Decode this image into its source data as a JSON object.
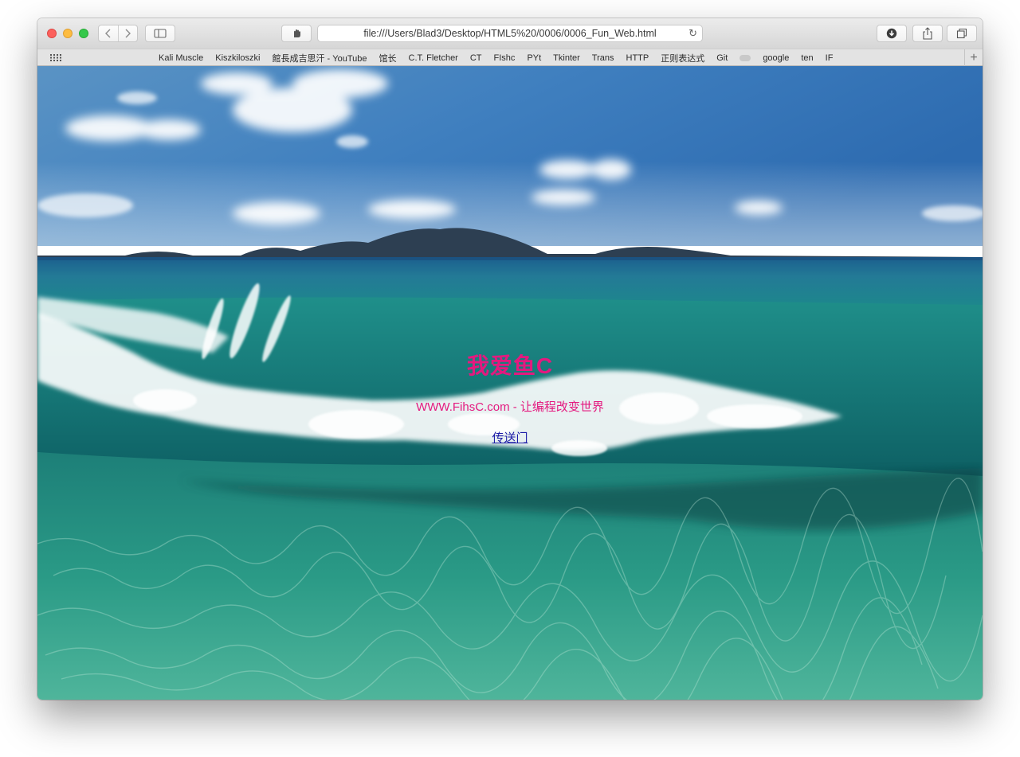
{
  "browser": {
    "address_url": "file:///Users/Blad3/Desktop/HTML5%20/0006/0006_Fun_Web.html",
    "icons": {
      "back": "chevron-left-icon",
      "forward": "chevron-right-icon",
      "sidebar": "sidebar-icon",
      "privacy": "hand-icon",
      "reload": "reload-icon",
      "download": "download-icon",
      "share": "share-icon",
      "tabs": "tabs-icon",
      "top_sites": "grid-icon",
      "new_tab": "plus-icon"
    }
  },
  "bookmarks": [
    "Kali Muscle",
    "Kiszkiloszki",
    "館長成吉思汗 - YouTube",
    "馆长",
    "C.T. Fletcher",
    "CT",
    "FIshc",
    "PYt",
    "Tkinter",
    "Trans",
    "HTTP",
    "正则表达式",
    "Git",
    "google",
    "ten",
    "IF"
  ],
  "page": {
    "headline": "我爱鱼C",
    "subtitle": "WWW.FihsC.com - 让编程改变世界",
    "link_text": "传送门",
    "text_color": "#e4197f",
    "link_color": "#1a1aa6",
    "background": "ocean-wave-photo"
  }
}
